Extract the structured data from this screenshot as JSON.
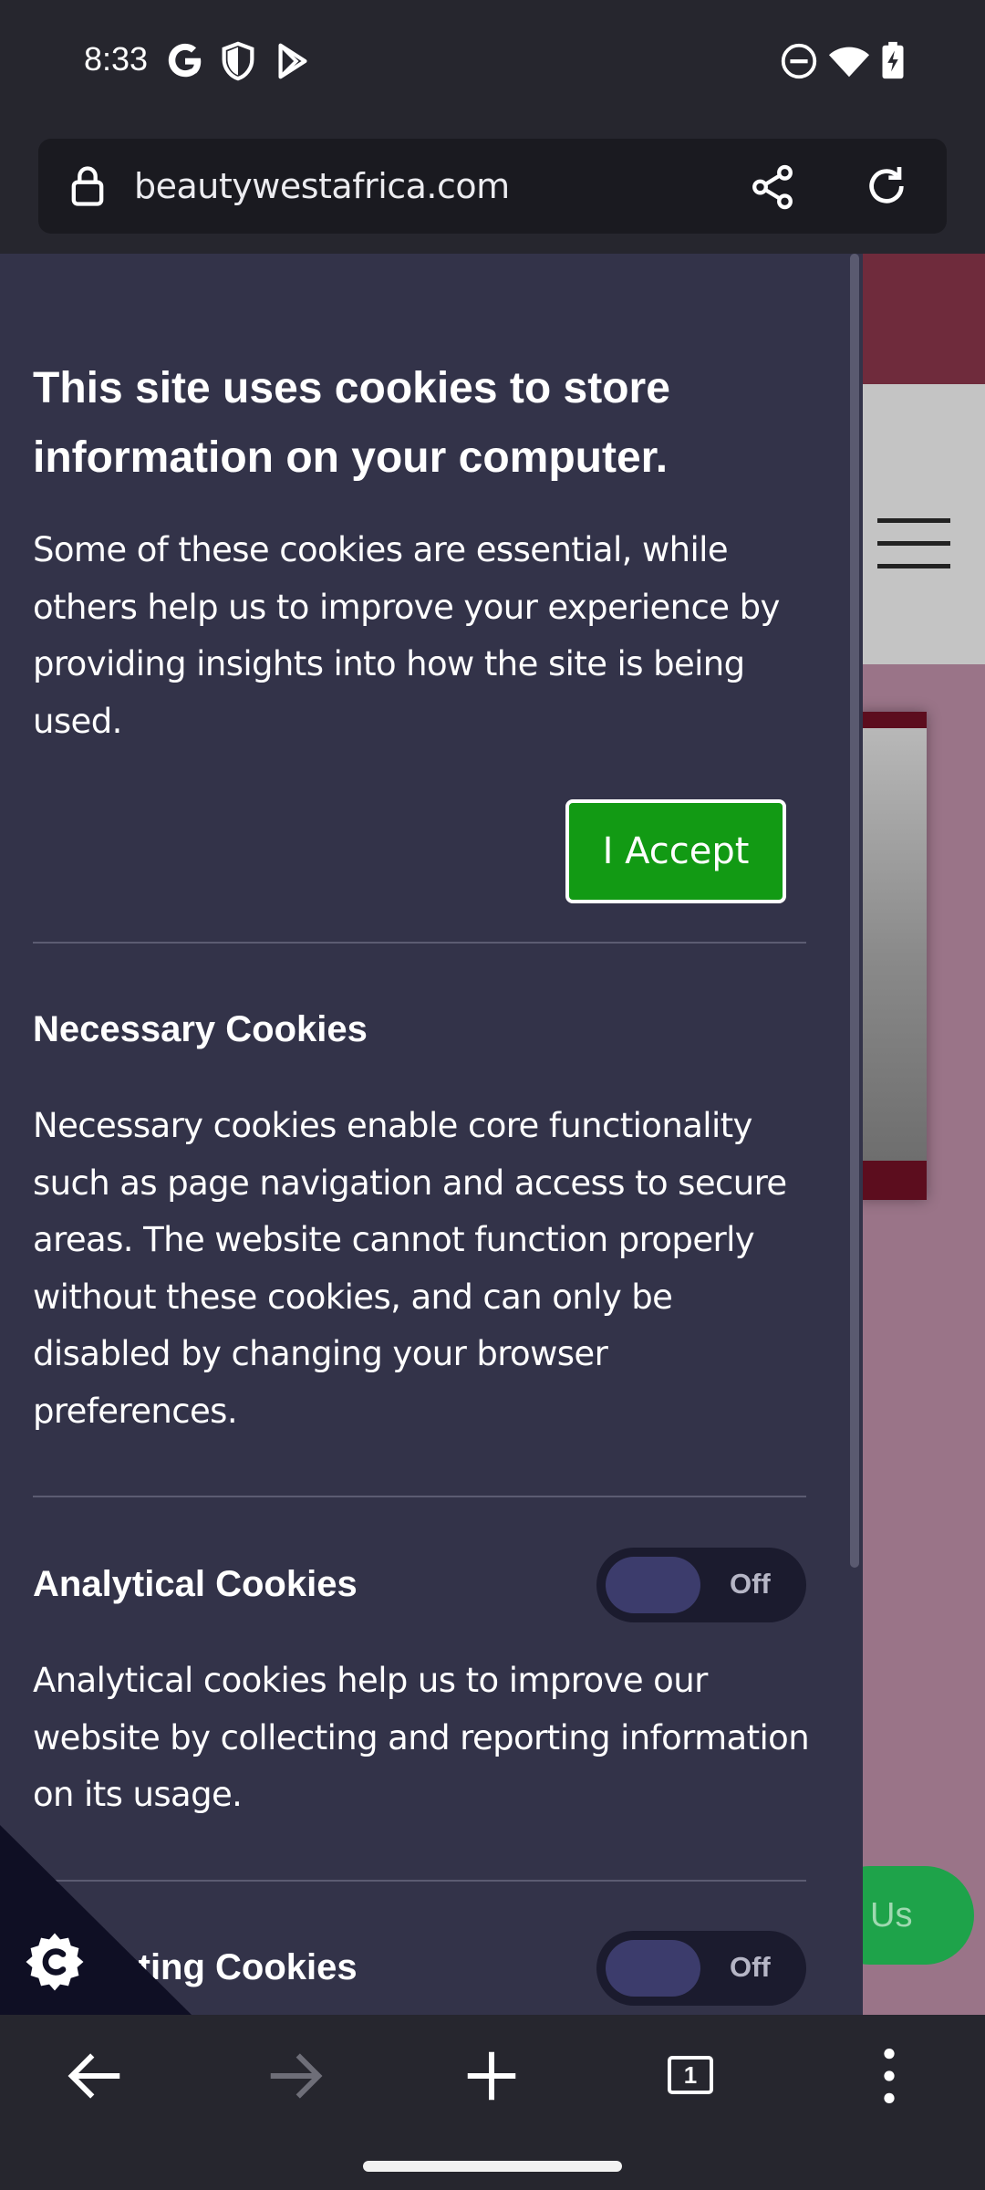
{
  "status_bar": {
    "time": "8:33",
    "left_icons": [
      "google-icon",
      "shield-icon",
      "play-store-icon"
    ],
    "right_icons": [
      "do-not-disturb-icon",
      "wifi-icon",
      "battery-charging-icon"
    ]
  },
  "browser": {
    "url": "beautywestafrica.com",
    "icons": [
      "lock-icon",
      "share-icon",
      "reload-icon"
    ],
    "tab_count": "1"
  },
  "cookie_banner": {
    "title": "This site uses cookies to store information on your computer.",
    "intro": "Some of these cookies are essential, while others help us to improve your experience by providing insights into how the site is being used.",
    "accept_label": "I Accept",
    "sections": [
      {
        "title": "Necessary Cookies",
        "text": "Necessary cookies enable core functionality such as page navigation and access to secure areas. The website cannot function properly without these cookies, and can only be disabled by changing your browser preferences."
      },
      {
        "title": "Analytical Cookies",
        "toggle": "Off",
        "text": "Analytical cookies help us to improve our website by collecting and reporting information on its usage."
      },
      {
        "title": "Marketing Cookies",
        "toggle": "Off"
      }
    ]
  },
  "page_behind": {
    "contact_button_partial": "Us"
  },
  "colors": {
    "panel_bg": "#333349",
    "accept_green": "#129a14",
    "contact_green": "#1ea34a",
    "browser_chrome": "#26262e"
  }
}
